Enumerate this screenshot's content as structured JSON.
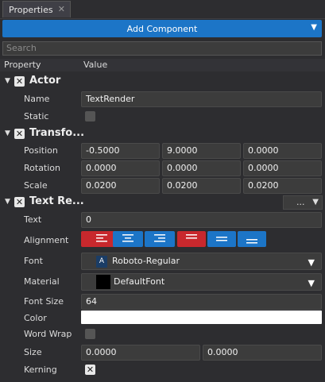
{
  "tab": {
    "title": "Properties"
  },
  "toolbar": {
    "add_component_label": "Add Component"
  },
  "search": {
    "placeholder": "Search"
  },
  "columns": {
    "property": "Property",
    "value": "Value"
  },
  "actor": {
    "title": "Actor",
    "name_label": "Name",
    "name_value": "TextRender",
    "static_label": "Static",
    "static_checked": false
  },
  "transform": {
    "title": "Transfo...",
    "position_label": "Position",
    "position": [
      "-0.5000",
      "9.0000",
      "0.0000"
    ],
    "rotation_label": "Rotation",
    "rotation": [
      "0.0000",
      "0.0000",
      "0.0000"
    ],
    "scale_label": "Scale",
    "scale": [
      "0.0200",
      "0.0200",
      "0.0200"
    ]
  },
  "text_render": {
    "title": "Text Re...",
    "more_label": "...",
    "text_label": "Text",
    "text_value": "0",
    "alignment_label": "Alignment",
    "font_label": "Font",
    "font_value": "Roboto-Regular",
    "material_label": "Material",
    "material_value": "DefaultFont",
    "font_size_label": "Font Size",
    "font_size_value": "64",
    "color_label": "Color",
    "color_value": "#ffffff",
    "word_wrap_label": "Word Wrap",
    "word_wrap_checked": false,
    "size_label": "Size",
    "size": [
      "0.0000",
      "0.0000"
    ],
    "kerning_label": "Kerning",
    "kerning_checked": true
  },
  "colors": {
    "accent": "#1c75c7",
    "align_red": "#c8282d",
    "align_blue": "#1c75c7"
  }
}
